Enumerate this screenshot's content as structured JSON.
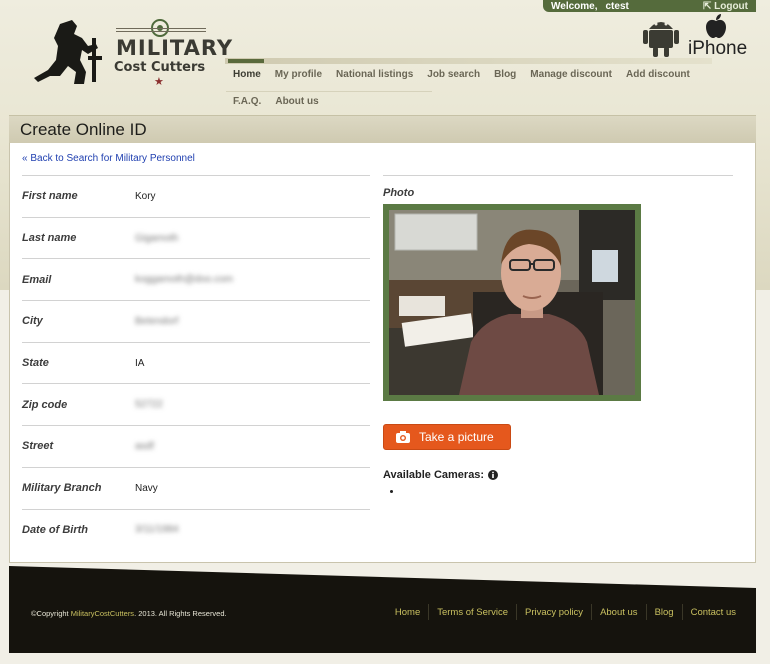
{
  "userbar": {
    "welcome": "Welcome,",
    "username": "ctest",
    "logout": "Logout"
  },
  "logo": {
    "title": "MILITARY",
    "subtitle": "Cost Cutters"
  },
  "platforms": {
    "iphone_label": "iPhone"
  },
  "nav": {
    "items": [
      {
        "label": "Home",
        "active": true
      },
      {
        "label": "My profile"
      },
      {
        "label": "National listings"
      },
      {
        "label": "Job search"
      },
      {
        "label": "Blog"
      },
      {
        "label": "Manage discount"
      },
      {
        "label": "Add discount"
      },
      {
        "label": "F.A.Q."
      },
      {
        "label": "About us"
      }
    ]
  },
  "page": {
    "title": "Create Online ID"
  },
  "back_link": "« Back to Search for Military Personnel",
  "fields": [
    {
      "label": "First name",
      "value": "Kory",
      "blurred": false
    },
    {
      "label": "Last name",
      "value": "Gigamoth",
      "blurred": true
    },
    {
      "label": "Email",
      "value": "koggamoth@doo.com",
      "blurred": true
    },
    {
      "label": "City",
      "value": "Betendorf",
      "blurred": true
    },
    {
      "label": "State",
      "value": "IA",
      "blurred": false
    },
    {
      "label": "Zip code",
      "value": "52722",
      "blurred": true
    },
    {
      "label": "Street",
      "value": "asdf",
      "blurred": true
    },
    {
      "label": "Military Branch",
      "value": "Navy",
      "blurred": false
    },
    {
      "label": "Date of Birth",
      "value": "3/11/1984",
      "blurred": true
    }
  ],
  "photo": {
    "label": "Photo"
  },
  "camera": {
    "button_label": "Take a picture",
    "available_label": "Available Cameras:"
  },
  "footer": {
    "copyright_prefix": "©Copyright ",
    "copyright_brand": "MilitaryCostCutters",
    "copyright_suffix": ". 2013. All Rights Reserved.",
    "links": [
      "Home",
      "Terms of Service",
      "Privacy policy",
      "About us",
      "Blog",
      "Contact us"
    ]
  },
  "colors": {
    "accent_green": "#556b3c",
    "button_orange": "#e5581d",
    "link_blue": "#1f3fb0",
    "footer_link": "#c9c060"
  }
}
